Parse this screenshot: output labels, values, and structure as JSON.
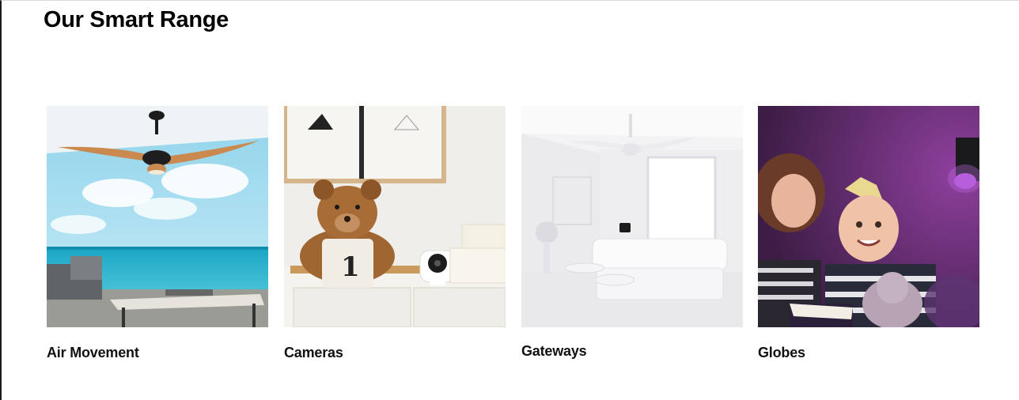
{
  "section": {
    "title": "Our Smart Range"
  },
  "categories": [
    {
      "label": "Air Movement",
      "image": "ceiling-fan-ocean-view"
    },
    {
      "label": "Cameras",
      "image": "teddy-bear-security-camera"
    },
    {
      "label": "Gateways",
      "image": "white-living-room-gateway"
    },
    {
      "label": "Globes",
      "image": "mother-child-purple-smart-globe"
    }
  ]
}
